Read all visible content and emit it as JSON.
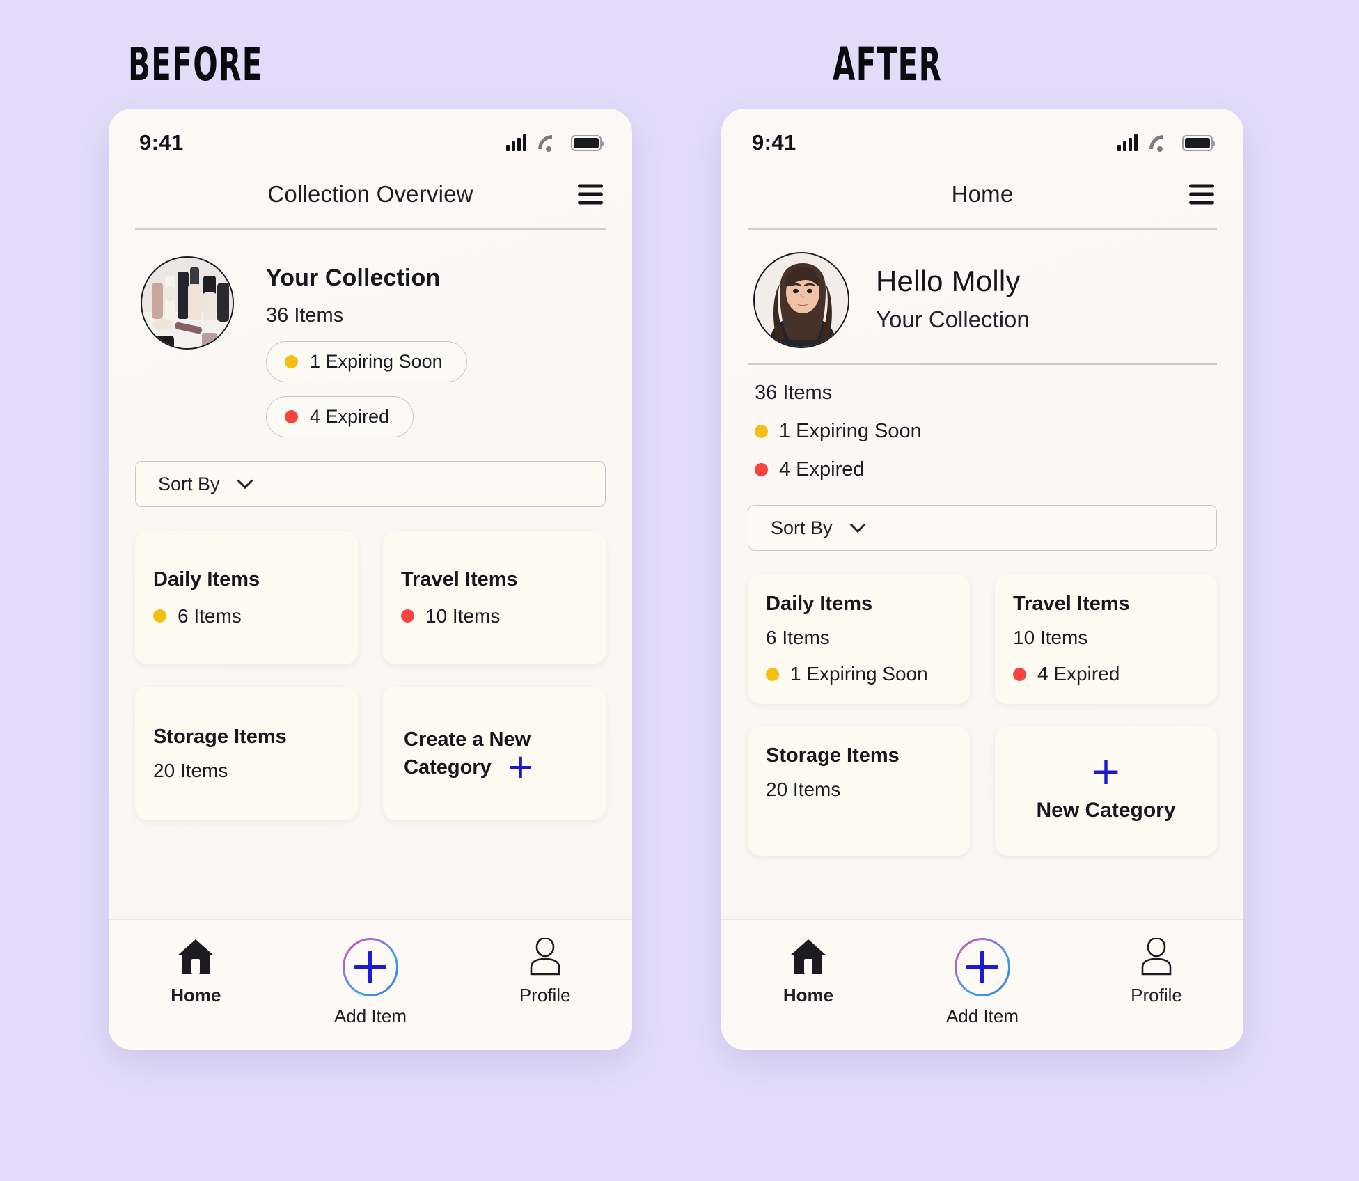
{
  "page": {
    "background_color": "#E2DCFA",
    "accent_blue": "#1A1ACB",
    "warning_color": "#F5BE12",
    "danger_color": "#F8443F"
  },
  "before": {
    "label": "BEFORE",
    "statusbar": {
      "time": "9:41",
      "signal_icon": "cellular-signal-icon",
      "wifi_icon": "wifi-icon",
      "battery_icon": "battery-full-icon"
    },
    "appbar": {
      "title": "Collection Overview",
      "menu_icon": "hamburger-menu-icon"
    },
    "collection": {
      "photo_alt": "makeup-collection-photo",
      "title": "Your Collection",
      "count": "36 Items",
      "badges": [
        {
          "label": "1 Expiring Soon",
          "dot_color": "#F5BE12"
        },
        {
          "label": "4 Expired",
          "dot_color": "#F8443F"
        }
      ]
    },
    "sort": {
      "label": "Sort By",
      "chevron_icon": "chevron-down-icon"
    },
    "cards": [
      {
        "title": "Daily Items",
        "count": "6 Items",
        "dot_color": "#F5BE12"
      },
      {
        "title": "Travel Items",
        "count": "10 Items",
        "dot_color": "#F8443F"
      },
      {
        "title": "Storage Items",
        "count": "20 Items",
        "dot_color": null
      }
    ],
    "new_category": {
      "line1": "Create a New",
      "line2": "Category",
      "plus_icon": "plus-icon",
      "plus_color": "#1A1ACB"
    },
    "tabbar": [
      {
        "label": "Home",
        "icon": "home-icon",
        "active": true
      },
      {
        "label": "Add Item",
        "icon": "add-circle-plus-icon",
        "active": false
      },
      {
        "label": "Profile",
        "icon": "person-icon",
        "active": false
      }
    ]
  },
  "after": {
    "label": "AFTER",
    "statusbar": {
      "time": "9:41",
      "signal_icon": "cellular-signal-icon",
      "wifi_icon": "wifi-icon",
      "battery_icon": "battery-full-icon"
    },
    "appbar": {
      "title": "Home",
      "menu_icon": "hamburger-menu-icon"
    },
    "greeting": {
      "avatar_alt": "user-avatar-photo",
      "hello": "Hello Molly",
      "subtitle": "Your Collection"
    },
    "stats": {
      "count": "36 Items",
      "lines": [
        {
          "label": "1 Expiring Soon",
          "dot_color": "#F5BE12"
        },
        {
          "label": "4 Expired",
          "dot_color": "#F8443F"
        }
      ]
    },
    "sort": {
      "label": "Sort By",
      "chevron_icon": "chevron-down-icon"
    },
    "cards": [
      {
        "title": "Daily Items",
        "count": "6 Items",
        "status": "1 Expiring Soon",
        "dot_color": "#F5BE12"
      },
      {
        "title": "Travel Items",
        "count": "10 Items",
        "status": "4 Expired",
        "dot_color": "#F8443F"
      },
      {
        "title": "Storage Items",
        "count": "20 Items",
        "status": "",
        "dot_color": null
      }
    ],
    "new_category": {
      "title": "New Category",
      "plus_icon": "plus-icon",
      "plus_color": "#1A1ACB"
    },
    "tabbar": [
      {
        "label": "Home",
        "icon": "home-icon",
        "active": true
      },
      {
        "label": "Add Item",
        "icon": "add-circle-plus-icon",
        "active": false
      },
      {
        "label": "Profile",
        "icon": "person-icon",
        "active": false
      }
    ]
  }
}
